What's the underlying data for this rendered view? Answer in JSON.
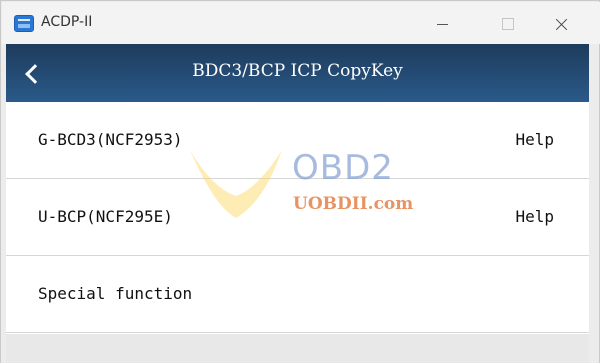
{
  "window": {
    "title": "ACDP-II",
    "icon": "acdp-app-icon",
    "controls": {
      "minimize": "minimize-icon",
      "maximize": "maximize-icon",
      "close": "close-icon"
    }
  },
  "header": {
    "title": "BDC3/BCP ICP CopyKey",
    "back_icon": "chevron-left-icon",
    "color_top": "#1e3b5c",
    "color_bottom": "#2a5a8a"
  },
  "list": {
    "items": [
      {
        "label": "G-BCD3(NCF2953)",
        "help": "Help"
      },
      {
        "label": "U-BCP(NCF295E)",
        "help": "Help"
      },
      {
        "label": "Special function"
      }
    ]
  },
  "watermark": {
    "brand": "OBD2",
    "site": "UOBDII.com"
  }
}
